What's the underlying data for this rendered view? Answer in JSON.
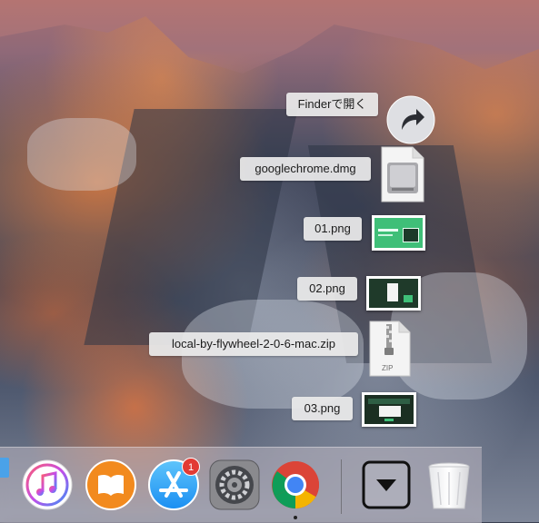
{
  "stack": {
    "items": [
      {
        "label": "Finderで開く",
        "icon": "arrow-icon"
      },
      {
        "label": "googlechrome.dmg",
        "icon": "disk-image-icon"
      },
      {
        "label": "01.png",
        "icon": "png-thumbnail"
      },
      {
        "label": "02.png",
        "icon": "png-thumbnail"
      },
      {
        "label": "local-by-flywheel-2-0-6-mac.zip",
        "icon": "zip-file-icon",
        "badge_text": "ZIP"
      },
      {
        "label": "03.png",
        "icon": "png-thumbnail"
      }
    ]
  },
  "dock": {
    "apps": [
      {
        "name": "iTunes",
        "icon": "itunes-icon"
      },
      {
        "name": "iBooks",
        "icon": "ibooks-icon"
      },
      {
        "name": "App Store",
        "icon": "app-store-icon",
        "badge": "1"
      },
      {
        "name": "System Preferences",
        "icon": "system-preferences-icon"
      },
      {
        "name": "Google Chrome",
        "icon": "chrome-icon",
        "running": true
      },
      {
        "name": "Downloads",
        "icon": "downloads-stack-icon"
      },
      {
        "name": "Trash",
        "icon": "trash-icon"
      }
    ]
  },
  "colors": {
    "badge": "#e23b34",
    "chrome_red": "#db4437",
    "chrome_green": "#0f9d58",
    "chrome_yellow": "#f4b400",
    "chrome_blue": "#4285f4",
    "appstore_blue": "#1b8ff2"
  }
}
